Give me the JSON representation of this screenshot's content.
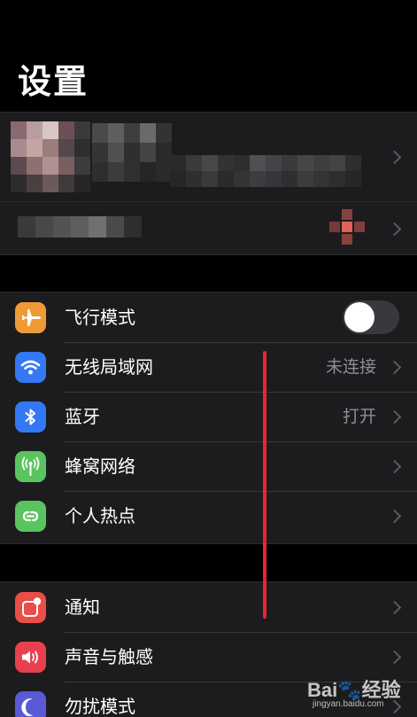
{
  "header": {
    "title": "设置"
  },
  "account": {
    "avatar_colors": [
      "#8a6a72",
      "#b79da0",
      "#d6c6c4",
      "#6e4f55",
      "#3a3a3c",
      "#a98b8f",
      "#c4a5a2",
      "#9c7c7c",
      "#54484a",
      "#2e2e30",
      "#5e4a4e",
      "#8f7072",
      "#b09090",
      "#7a5e60",
      "#3c3c3e",
      "#2c2c2e",
      "#4a3f41",
      "#6b5a5c",
      "#3f3a3b",
      "#262628"
    ],
    "name_colors": [
      "#4a4a4c",
      "#5e5e60",
      "#3e3e40",
      "#6a6a6c",
      "#333335",
      "#353537",
      "#505052",
      "#2f2f31",
      "#444446",
      "#2a2a2c",
      "#2e2e30",
      "#3c3c3e",
      "#303032",
      "#262628",
      "#2b2b2d"
    ],
    "id_colors": [
      "#2a2a2c",
      "#3a3a3c",
      "#48484a",
      "#333335",
      "#2e2e30",
      "#505052",
      "#444446",
      "#3a3a3c",
      "#474749",
      "#3e3e40",
      "#444446",
      "#2e2e30",
      "#262628",
      "#2f2f31",
      "#3a3a3c",
      "#2b2b2d",
      "#343436",
      "#3d3d3f",
      "#36363a",
      "#2f2f31",
      "#3c3c3e",
      "#343436",
      "#2e2e30",
      "#262628"
    ],
    "sub_colors": [
      "#3a3a3c",
      "#48484a",
      "#535355",
      "#5e5e60",
      "#707072",
      "#4a4a4c",
      "#2e2e30"
    ],
    "badge_color": "#e0605a"
  },
  "group1": {
    "airplane": {
      "label": "飞行模式",
      "icon": "airplane-icon",
      "color": "#f09a37",
      "toggle_on": false
    },
    "wifi": {
      "label": "无线局域网",
      "value": "未连接",
      "icon": "wifi-icon",
      "color": "#3478f6"
    },
    "bluetooth": {
      "label": "蓝牙",
      "value": "打开",
      "icon": "bluetooth-icon",
      "color": "#3478f6"
    },
    "cellular": {
      "label": "蜂窝网络",
      "icon": "antenna-icon",
      "color": "#5ac45f"
    },
    "hotspot": {
      "label": "个人热点",
      "icon": "hotspot-link-icon",
      "color": "#5ac45f"
    }
  },
  "group2": {
    "notifications": {
      "label": "通知",
      "icon": "notification-icon",
      "color": "#eb4d47"
    },
    "sounds": {
      "label": "声音与触感",
      "icon": "speaker-icon",
      "color": "#e8404f"
    },
    "dnd": {
      "label": "勿扰模式",
      "icon": "moon-icon",
      "color": "#5b5ad6"
    }
  },
  "annotation": {
    "color": "#e8262d"
  },
  "watermark": {
    "brand": "Bai",
    "brand_suffix": "经验",
    "url": "jingyan.baidu.com"
  }
}
